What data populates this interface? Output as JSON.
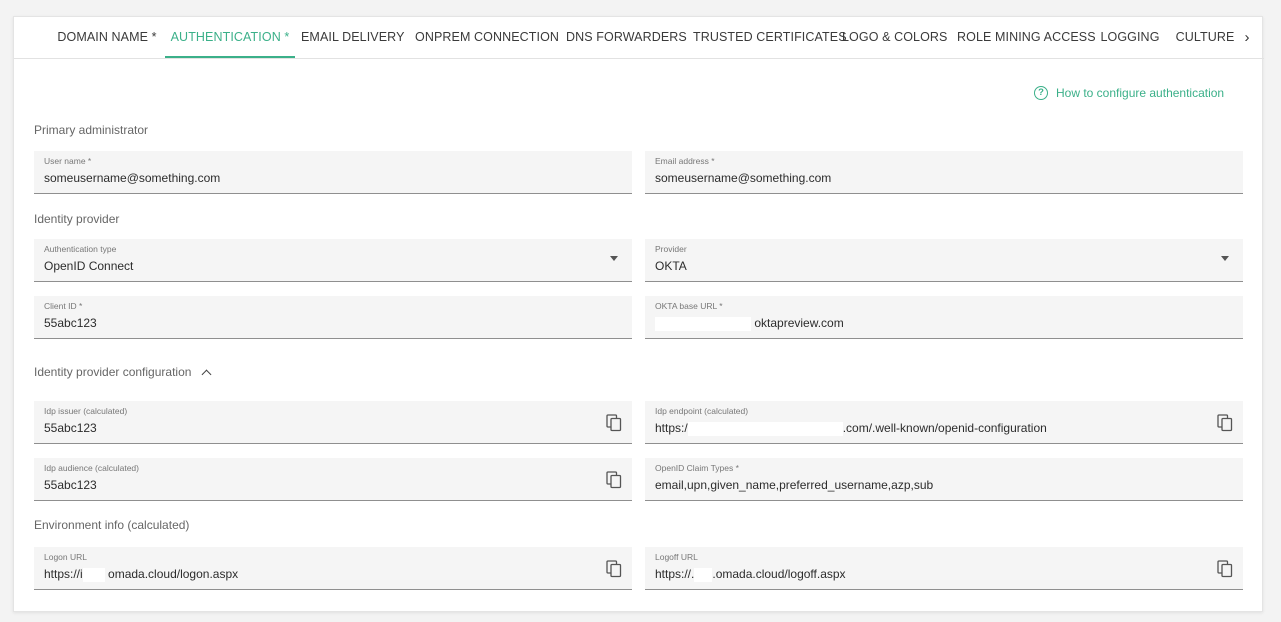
{
  "tabs": [
    {
      "label": "DOMAIN NAME *",
      "active": false
    },
    {
      "label": "AUTHENTICATION *",
      "active": true
    },
    {
      "label": "EMAIL DELIVERY",
      "active": false
    },
    {
      "label": "ONPREM CONNECTION",
      "active": false
    },
    {
      "label": "DNS FORWARDERS",
      "active": false
    },
    {
      "label": "TRUSTED CERTIFICATES",
      "active": false
    },
    {
      "label": "LOGO & COLORS",
      "active": false
    },
    {
      "label": "ROLE MINING ACCESS",
      "active": false
    },
    {
      "label": "LOGGING",
      "active": false
    },
    {
      "label": "CULTURE",
      "active": false
    }
  ],
  "tabs_next_glyph": "›",
  "help_link": {
    "label": "How to configure authentication",
    "icon": "?"
  },
  "colors": {
    "accent": "#3bb089",
    "field_bg": "#f5f5f5",
    "underline": "#8f8f8f"
  },
  "sections": {
    "primary_admin": "Primary administrator",
    "identity_provider": "Identity provider",
    "idp_config": "Identity provider configuration",
    "environment": "Environment info (calculated)"
  },
  "fields": {
    "user_name": {
      "label": "User name *",
      "value": "someusername@something.com"
    },
    "email": {
      "label": "Email address *",
      "value": "someusername@something.com"
    },
    "auth_type": {
      "label": "Authentication type",
      "value": "OpenID Connect"
    },
    "provider": {
      "label": "Provider",
      "value": "OKTA"
    },
    "client_id": {
      "label": "Client ID *",
      "value": "55abc123"
    },
    "okta_base_url": {
      "label": "OKTA base URL *",
      "value_suffix": "oktapreview.com"
    },
    "idp_issuer": {
      "label": "Idp issuer (calculated)",
      "value": "55abc123"
    },
    "idp_endpoint": {
      "label": "Idp endpoint (calculated)",
      "value_prefix": "https:/",
      "value_suffix": ".com/.well-known/openid-configuration"
    },
    "idp_audience": {
      "label": "Idp audience (calculated)",
      "value": "55abc123"
    },
    "claim_types": {
      "label": "OpenID Claim Types *",
      "value": "email,upn,given_name,preferred_username,azp,sub"
    },
    "logon_url": {
      "label": "Logon URL",
      "value_prefix": "https://i",
      "value_suffix": "omada.cloud/logon.aspx"
    },
    "logoff_url": {
      "label": "Logoff URL",
      "value_prefix": "https://.",
      "value_suffix": ".omada.cloud/logoff.aspx"
    }
  }
}
